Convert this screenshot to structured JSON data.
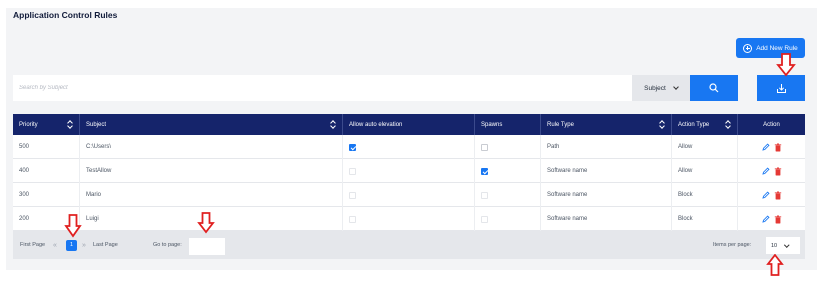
{
  "title": "Application Control Rules",
  "add_button": {
    "label": "Add New Rule",
    "icon": "plus-circle-icon"
  },
  "search": {
    "placeholder": "Search by Subject",
    "value": ""
  },
  "subject_filter": {
    "selected": "Subject"
  },
  "table": {
    "columns": [
      "Priority",
      "Subject",
      "Allow auto elevation",
      "Spawns",
      "Rule Type",
      "Action Type",
      "Action"
    ],
    "rows": [
      {
        "priority": "500",
        "subject": "C:\\Users\\",
        "allow_auto_elevation": true,
        "spawns": false,
        "rule_type": "Path",
        "action_type": "Allow"
      },
      {
        "priority": "400",
        "subject": "TestAllow",
        "allow_auto_elevation": false,
        "spawns": true,
        "rule_type": "Software name",
        "action_type": "Allow"
      },
      {
        "priority": "300",
        "subject": "Mario",
        "allow_auto_elevation": false,
        "spawns": false,
        "rule_type": "Software name",
        "action_type": "Block"
      },
      {
        "priority": "200",
        "subject": "Luigi",
        "allow_auto_elevation": false,
        "spawns": false,
        "rule_type": "Software name",
        "action_type": "Block"
      }
    ]
  },
  "pagination": {
    "first_label": "First Page",
    "last_label": "Last Page",
    "current_page": "1",
    "goto_label": "Go to page:",
    "items_per_page_label": "Items per page:",
    "items_per_page": "10"
  },
  "colors": {
    "primary": "#1877f2",
    "header": "#15246b",
    "delete": "#e53935",
    "annotation": "#e02020"
  }
}
